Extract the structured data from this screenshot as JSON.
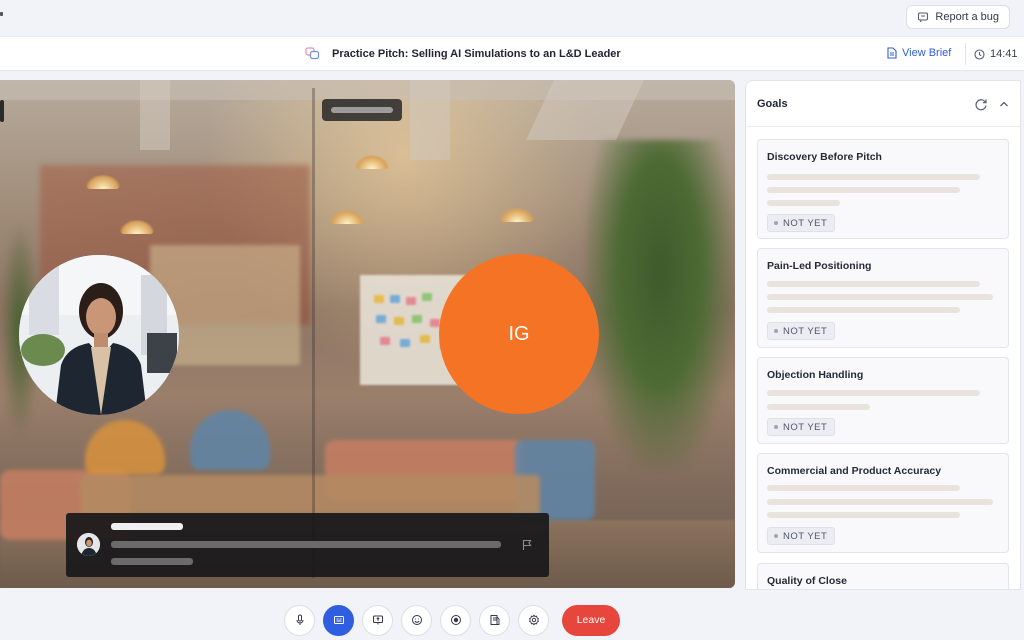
{
  "topbar": {
    "report_bug_label": "Report a bug",
    "report_icon": "bug-report-icon"
  },
  "header": {
    "title": "Practice Pitch: Selling AI Simulations to an L&D Leader",
    "title_icon": "chat-bubbles-icon",
    "view_brief_label": "View Brief",
    "timer": "14:41"
  },
  "video": {
    "participant_initials": "IG",
    "participant_avatar_color": "#f47325"
  },
  "goals": {
    "heading": "Goals",
    "items": [
      {
        "title": "Discovery Before Pitch",
        "status": "NOT YET"
      },
      {
        "title": "Pain-Led Positioning",
        "status": "NOT YET"
      },
      {
        "title": "Objection Handling",
        "status": "NOT YET"
      },
      {
        "title": "Commercial and Product Accuracy",
        "status": "NOT YET"
      },
      {
        "title": "Quality of Close",
        "status": ""
      }
    ]
  },
  "controls": {
    "leave_label": "Leave",
    "buttons": [
      "microphone-icon",
      "captions-icon",
      "screen-share-icon",
      "emoji-icon",
      "record-icon",
      "notes-icon",
      "settings-icon"
    ],
    "active_button": "captions-icon",
    "accent": "#2f5fe0",
    "leave_color": "#e7463c"
  }
}
